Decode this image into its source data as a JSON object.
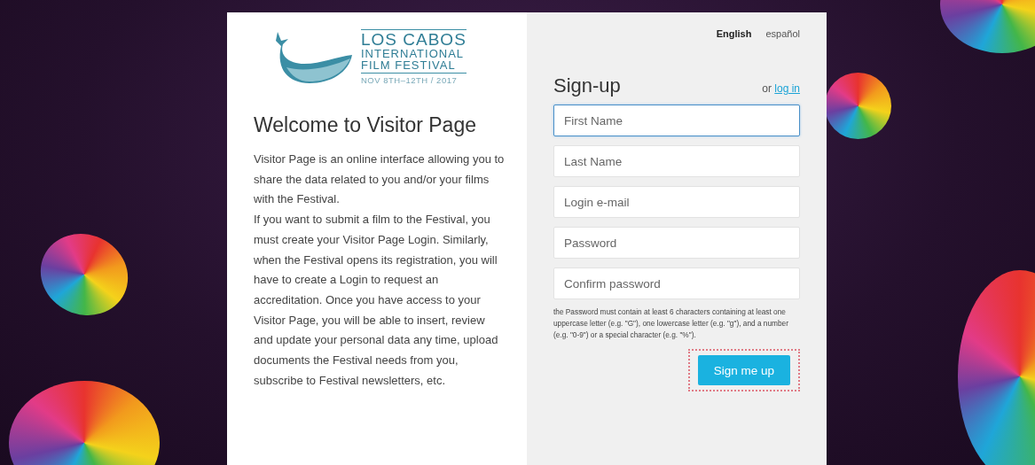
{
  "logo": {
    "lines": [
      "LOS CABOS",
      "INTERNATIONAL",
      "FILM FESTIVAL"
    ],
    "dates": "NOV 8TH–12TH / 2017"
  },
  "welcome": {
    "title": "Welcome to Visitor Page",
    "paragraphs": [
      "Visitor Page is an online interface allowing you to share the data related to you and/or your films with the Festival.",
      "If you want to submit a film to the Festival, you must create your Visitor Page Login. Similarly, when the Festival opens its registration, you will have to create a Login to request an accreditation. Once you have access to your Visitor Page, you will be able to insert, review and update your personal data any time, upload documents the Festival needs from you, subscribe to Festival newsletters, etc."
    ]
  },
  "languages": [
    {
      "label": "English",
      "selected": true
    },
    {
      "label": "español",
      "selected": false
    }
  ],
  "signup": {
    "title": "Sign-up",
    "alt_prefix": "or",
    "alt_link": "log in",
    "fields": [
      {
        "placeholder": "First Name",
        "focused": true
      },
      {
        "placeholder": "Last Name",
        "focused": false
      },
      {
        "placeholder": "Login e-mail",
        "focused": false
      },
      {
        "placeholder": "Password",
        "focused": false
      },
      {
        "placeholder": "Confirm password",
        "focused": false
      }
    ],
    "hint": "the Password must contain at least 6 characters containing at least one uppercase letter (e.g. \"G\"), one lowercase letter (e.g. \"g\"), and a number (e.g. \"0-9\") or a special character (e.g. \"%\").",
    "button": {
      "label": "Sign me up",
      "highlighted": true
    }
  }
}
